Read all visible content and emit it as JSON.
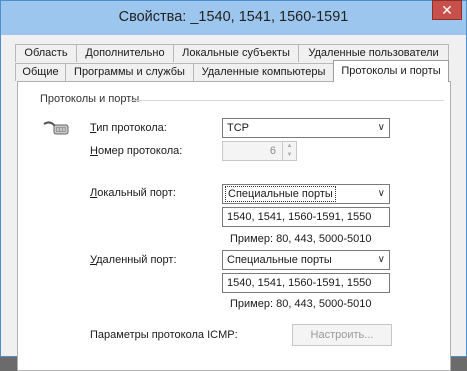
{
  "window": {
    "title": "Свойства: _1540, 1541, 1560-1591",
    "close_label": "✕"
  },
  "tabs_top": [
    {
      "label": "Область"
    },
    {
      "label": "Дополнительно"
    },
    {
      "label": "Локальные субъекты"
    },
    {
      "label": "Удаленные пользователи"
    }
  ],
  "tabs_bottom": [
    {
      "label": "Общие"
    },
    {
      "label": "Программы и службы"
    },
    {
      "label": "Удаленные компьютеры"
    },
    {
      "label": "Протоколы и порты",
      "active": true
    }
  ],
  "group": {
    "title": "Протоколы и порты"
  },
  "protocol": {
    "type_label_key": "Т",
    "type_label_rest": "ип протокола:",
    "type_value": "TCP",
    "number_label_key": "Н",
    "number_label_rest": "омер протокола:",
    "number_value": "6"
  },
  "local_port": {
    "label_key": "Л",
    "label_rest": "окальный порт:",
    "select_value": "Специальные порты",
    "input_value": "1540, 1541, 1560-1591, 1550",
    "example": "Пример: 80, 443, 5000-5010"
  },
  "remote_port": {
    "label_key": "У",
    "label_rest": "даленный порт:",
    "select_value": "Специальные порты",
    "input_value": "1540, 1541, 1560-1591, 1550",
    "example": "Пример: 80, 443, 5000-5010"
  },
  "icmp": {
    "label": "Параметры протокола ICMP:",
    "button_label": "Настроить..."
  },
  "icons": {
    "protocol_icon": "network-cable-icon",
    "dropdown_icon": "chevron-down-icon"
  },
  "colors": {
    "titlebar": "#9dc6ee",
    "close_button": "#c7504a"
  }
}
